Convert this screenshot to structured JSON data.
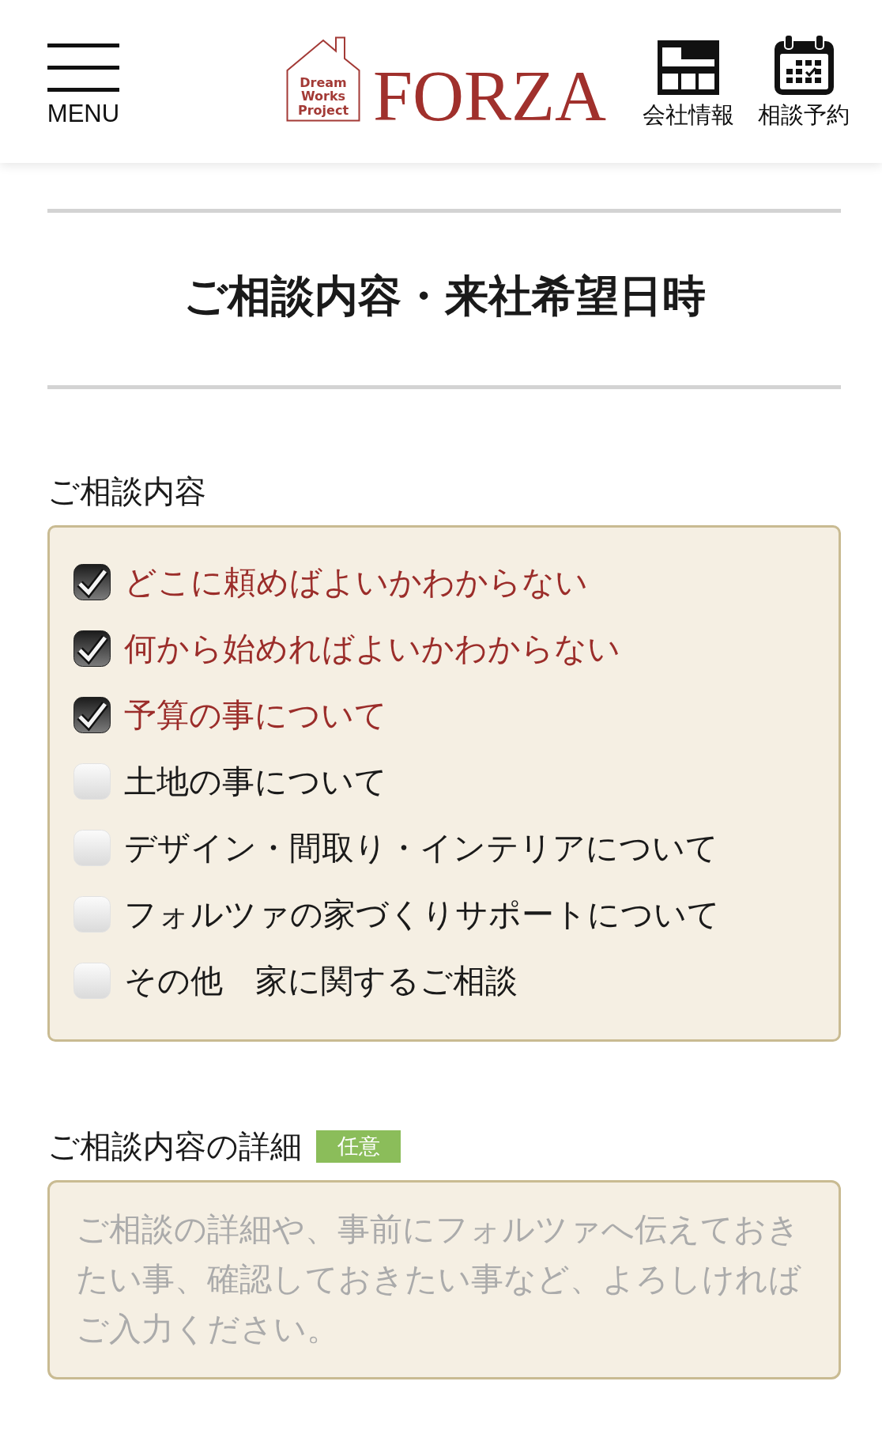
{
  "header": {
    "menu_label": "MENU",
    "logo": {
      "badge_lines": [
        "Dream",
        "Works",
        "Project"
      ],
      "name": "FORZA"
    },
    "nav": [
      {
        "kind": "company",
        "label": "会社情報"
      },
      {
        "kind": "calendar",
        "label": "相談予約"
      }
    ]
  },
  "page_title": "ご相談内容・来社希望日時",
  "consultation": {
    "label": "ご相談内容",
    "options": [
      {
        "label": "どこに頼めばよいかわからない",
        "checked": true
      },
      {
        "label": "何から始めればよいかわからない",
        "checked": true
      },
      {
        "label": "予算の事について",
        "checked": true
      },
      {
        "label": "土地の事について",
        "checked": false
      },
      {
        "label": "デザイン・間取り・インテリアについて",
        "checked": false
      },
      {
        "label": "フォルツァの家づくりサポートについて",
        "checked": false
      },
      {
        "label": "その他　家に関するご相談",
        "checked": false
      }
    ]
  },
  "details": {
    "label": "ご相談内容の詳細",
    "badge": "任意",
    "placeholder": "ご相談の詳細や、事前にフォルツァへ伝えておきたい事、確認しておきたい事など、よろしければご入力ください。"
  }
}
